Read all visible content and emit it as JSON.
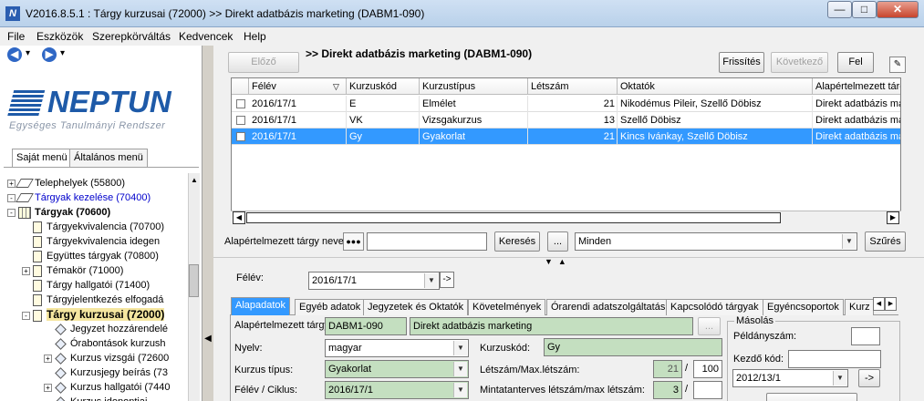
{
  "window": {
    "title": "V2016.8.5.1 : Tárgy kurzusai (72000)  >> Direkt adatbázis marketing (DABM1-090)",
    "icon_letter": "N",
    "minimize": "—",
    "maximize": "□",
    "close": "✕"
  },
  "menu": [
    "File",
    "Eszközök",
    "Szerepkörváltás",
    "Kedvencek",
    "Help"
  ],
  "nav": {
    "back_icon": "◀",
    "forward_icon": "▶",
    "dropdown": "▾"
  },
  "logo": {
    "name": "NEPTUN",
    "subtitle": "Egységes Tanulmányi Rendszer"
  },
  "left_tabs": {
    "own": "Saját menü",
    "general": "Általános menü"
  },
  "tree": [
    {
      "label": "Telephelyek (55800)",
      "icon": "book-icon",
      "exp": "+",
      "indent": 0
    },
    {
      "label": "Tárgyak kezelése (70400)",
      "icon": "book-icon",
      "exp": "-",
      "indent": 0,
      "color": "#0000cc"
    },
    {
      "label": "Tárgyak (70600)",
      "icon": "grid-icon",
      "exp": "-",
      "indent": 1,
      "bold": true
    },
    {
      "label": "Tárgyekvivalencia (70700)",
      "icon": "doc-icon",
      "indent": 2
    },
    {
      "label": "Tárgyekvivalencia idegen",
      "icon": "doc-icon",
      "indent": 2
    },
    {
      "label": "Együttes tárgyak (70800)",
      "icon": "doc-icon",
      "indent": 2
    },
    {
      "label": "Témakör (71000)",
      "icon": "doc-icon",
      "exp": "+",
      "indent": 2
    },
    {
      "label": "Tárgy hallgatói (71400)",
      "icon": "doc-icon",
      "indent": 2
    },
    {
      "label": "Tárgyjelentkezés elfogadá",
      "icon": "doc-icon",
      "indent": 2
    },
    {
      "label": "Tárgy kurzusai (72000)",
      "icon": "doc-icon",
      "exp": "-",
      "indent": 2,
      "bold": true,
      "highlight": true
    },
    {
      "label": "Jegyzet hozzárendelé",
      "icon": "diamond-icon",
      "indent": 3
    },
    {
      "label": "Órabontások kurzush",
      "icon": "diamond-icon",
      "indent": 3
    },
    {
      "label": "Kurzus vizsgái (72600",
      "icon": "diamond-icon",
      "exp": "+",
      "indent": 3
    },
    {
      "label": "Kurzusjegy beírás (73",
      "icon": "diamond-icon",
      "indent": 3
    },
    {
      "label": "Kurzus hallgatói (7440",
      "icon": "diamond-icon",
      "exp": "+",
      "indent": 3
    },
    {
      "label": "Kurzus idopontjai",
      "icon": "diamond-icon",
      "indent": 3
    }
  ],
  "toolbar": {
    "prev": "Előző",
    "title": ">> Direkt adatbázis marketing (DABM1-090)",
    "refresh": "Frissítés",
    "next": "Következő",
    "up": "Fel"
  },
  "grid": {
    "columns": [
      "Félév",
      "Kurzuskód",
      "Kurzustípus",
      "Létszám",
      "Oktatók",
      "Alapértelmezett tárgy"
    ],
    "sort_indicator": "▽",
    "rows": [
      {
        "semester": "2016/17/1",
        "code": "E",
        "type": "Elmélet",
        "count": "21",
        "teachers": "Nikodémus Pileir, Szellő Döbisz",
        "subject": "Direkt adatbázis mar"
      },
      {
        "semester": "2016/17/1",
        "code": "VK",
        "type": "Vizsgakurzus",
        "count": "13",
        "teachers": "Szellő Döbisz",
        "subject": "Direkt adatbázis mar"
      },
      {
        "semester": "2016/17/1",
        "code": "Gy",
        "type": "Gyakorlat",
        "count": "21",
        "teachers": "Kincs Ivánkay, Szellő Döbisz",
        "subject": "Direkt adatbázis mar",
        "selected": true
      }
    ]
  },
  "search": {
    "label": "Alapértelmezett tárgy neve",
    "dots": "●●●",
    "value": "",
    "button": "Keresés",
    "ellipsis": "...",
    "filter_value": "Minden",
    "filter_button": "Szűrés"
  },
  "splitter": {
    "arrows": "▼▲"
  },
  "semester": {
    "label": "Félév:",
    "value": "2016/17/1",
    "go": "->"
  },
  "tabs": [
    "Alapadatok",
    "Egyéb adatok",
    "Jegyzetek és Oktatók",
    "Követelmények",
    "Órarendi adatszolgáltatás",
    "Kapcsolódó tárgyak",
    "Egyéncsoportok",
    "Kurz"
  ],
  "form": {
    "subject_label": "Alapértelmezett tárgy:",
    "subject_code": "DABM1-090",
    "subject_name": "Direkt adatbázis marketing",
    "subject_btn": "...",
    "language_label": "Nyelv:",
    "language_value": "magyar",
    "code_label": "Kurzuskód:",
    "code_value": "Gy",
    "type_label": "Kurzus típus:",
    "type_value": "Gyakorlat",
    "count_label": "Létszám/Max.létszám:",
    "count_value": "21",
    "slash": "/",
    "max_count": "100",
    "term_label": "Félév / Ciklus:",
    "term_value": "2016/17/1",
    "curric_label": "Mintatanterves létszám/max létszám:",
    "curric_value": "3",
    "curric_max": ""
  },
  "copy": {
    "title": "Másolás",
    "count_label": "Példányszám:",
    "count_value": "",
    "start_label": "Kezdő kód:",
    "start_value": "",
    "semester_value": "2012/13/1",
    "go": "->"
  }
}
